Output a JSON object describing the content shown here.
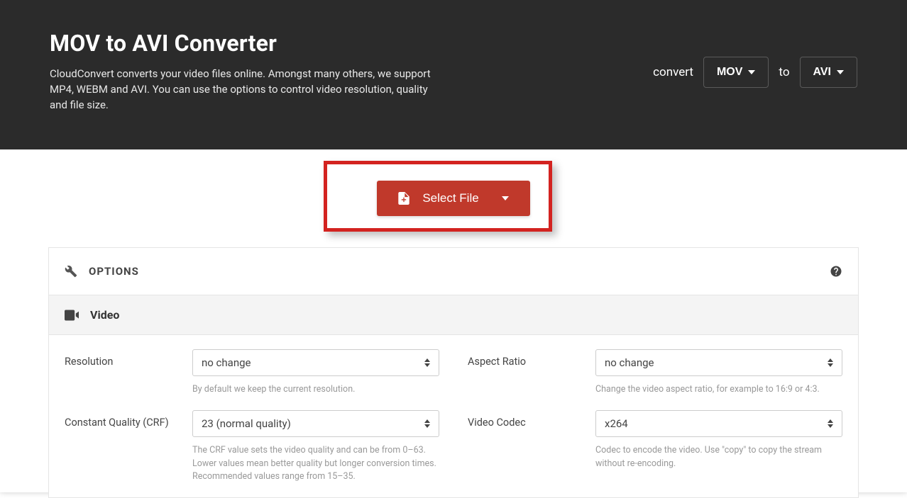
{
  "header": {
    "title": "MOV to AVI Converter",
    "description": "CloudConvert converts your video files online. Amongst many others, we support MP4, WEBM and AVI. You can use the options to control video resolution, quality and file size.",
    "convert_label": "convert",
    "from_format": "MOV",
    "to_label": "to",
    "to_format": "AVI"
  },
  "select_file": {
    "label": "Select File"
  },
  "options": {
    "title": "OPTIONS",
    "section_video": "Video",
    "resolution": {
      "label": "Resolution",
      "value": "no change",
      "helper": "By default we keep the current resolution."
    },
    "aspect_ratio": {
      "label": "Aspect Ratio",
      "value": "no change",
      "helper": "Change the video aspect ratio, for example to 16:9 or 4:3."
    },
    "crf": {
      "label": "Constant Quality (CRF)",
      "value": "23 (normal quality)",
      "helper": "The CRF value sets the video quality and can be from 0–63. Lower values mean better quality but longer conversion times. Recommended values range from 15–35."
    },
    "codec": {
      "label": "Video Codec",
      "value": "x264",
      "helper": "Codec to encode the video. Use \"copy\" to copy the stream without re-encoding."
    }
  }
}
